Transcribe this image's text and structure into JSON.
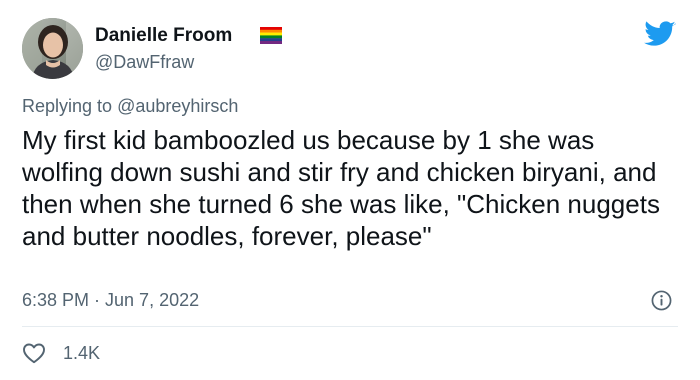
{
  "author": {
    "name": "Danielle Froom",
    "handle": "@DawFfraw",
    "avatar_icon": "profile-photo",
    "badge_icon": "pride-flag-icon"
  },
  "platform": {
    "logo_icon": "twitter-bird-icon",
    "brand_color": "#1d9bf0"
  },
  "reply": {
    "prefix": "Replying to",
    "handle": "@aubreyhirsch"
  },
  "tweet": {
    "text": "My first kid bamboozled us because by 1 she was wolfing down sushi and stir fry and chicken biryani, and then when she turned 6 she was like, \"Chicken nuggets and butter noodles, forever, please\"",
    "timestamp": "6:38 PM · Jun 7, 2022",
    "info_icon": "info-icon"
  },
  "engagement": {
    "like_icon": "heart-icon",
    "likes": "1.4K"
  },
  "colors": {
    "text_primary": "#0f1419",
    "text_secondary": "#536471",
    "divider": "#e6ecf0"
  }
}
